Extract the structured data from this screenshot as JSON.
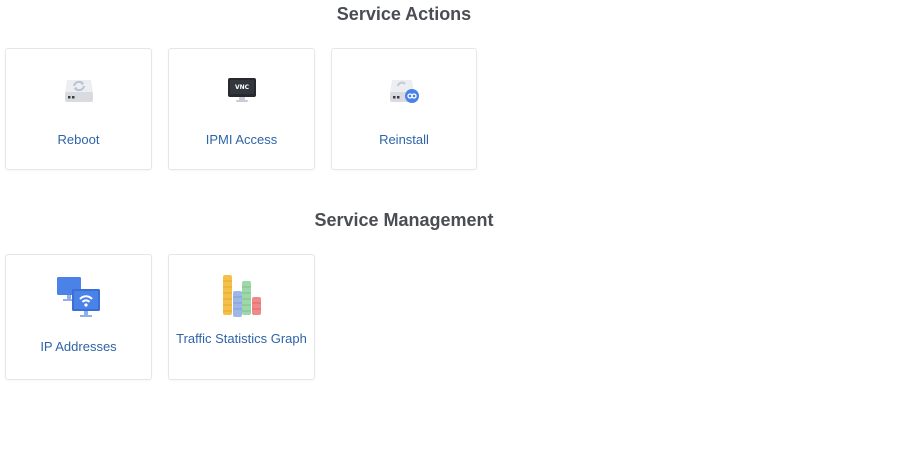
{
  "sections": [
    {
      "title": "Service Actions",
      "cards": [
        {
          "label": "Reboot",
          "icon": "server-reboot-icon"
        },
        {
          "label": "IPMI Access",
          "icon": "vnc-monitor-icon"
        },
        {
          "label": "Reinstall",
          "icon": "server-reinstall-icon"
        }
      ]
    },
    {
      "title": "Service Management",
      "cards": [
        {
          "label": "IP Addresses",
          "icon": "network-monitors-icon"
        },
        {
          "label": "Traffic Statistics Graph",
          "icon": "traffic-bars-icon"
        }
      ]
    }
  ],
  "colors": {
    "title": "#4a4d52",
    "link": "#2f64a8",
    "card_border": "#e4e6ea",
    "icon_blue": "#4a82e8",
    "icon_gray": "#d7d9de"
  }
}
